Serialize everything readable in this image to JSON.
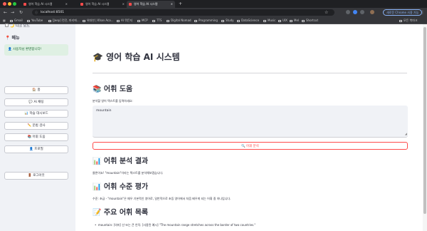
{
  "browser": {
    "tabs": [
      {
        "title": "영어 학습 AI 시스템",
        "active": false
      },
      {
        "title": "영어 학습 AI 시스템",
        "active": false
      },
      {
        "title": "영어 학습 AI 시스템",
        "active": true
      }
    ],
    "new_tab": "+",
    "url": "localhost:8501",
    "chrome_button": "새로운 Chrome 사용 가능",
    "bookmarks": [
      "Gmail",
      "YouTube",
      "[Jeep] 런던, 파리에...",
      "위대한 | Khan Aca...",
      "AI 뭐든지",
      "MCP",
      "TTS",
      "Digital Nomad",
      "Programming",
      "Study",
      "DataScience",
      "Music",
      "UIX",
      "Mel",
      "Shortcut"
    ],
    "all_bookmarks": "모든 북마크"
  },
  "sidebar": {
    "dark_mode_label": "🌙 다크 모드",
    "menu_title": "📍 메뉴",
    "welcome": "👤 사용자님 환영합니다!",
    "buttons": [
      "🏠 홈",
      "💬 AI 채팅",
      "📊 학습 대시보드",
      "✏️ 문법 검사",
      "📚 어휘 도움",
      "👤 프로필"
    ],
    "logout": "🚪 로그아웃"
  },
  "main": {
    "title": "🎓 영어 학습 AI 시스템",
    "vocab_header": "📚 어휘 도움",
    "input_label": "분석할 영어 텍스트를 입력하세요:",
    "input_value": "mountain",
    "analyze_button": "🔍 어휘 분석",
    "result_header": "📊 어휘 분석 결과",
    "result_text": "물론이죠! \"mountain\"이라는 텍스트를 분석해보겠습니다.",
    "level_header": "📊 어휘 수준 평가",
    "level_text": "수준: 초급 - \"mountain\"은 매우 기본적인 영어로, 일반적으로 초등 영어에서 처음 배우게 되는 어휘 중 하나입니다.",
    "key_vocab_header": "📝 주요 어휘 목록",
    "key_vocab_item": "mountain: [의미] 산 또는 큰 언덕. [사용된 예시] \"The mountain range stretches across the border of two countries.\""
  }
}
